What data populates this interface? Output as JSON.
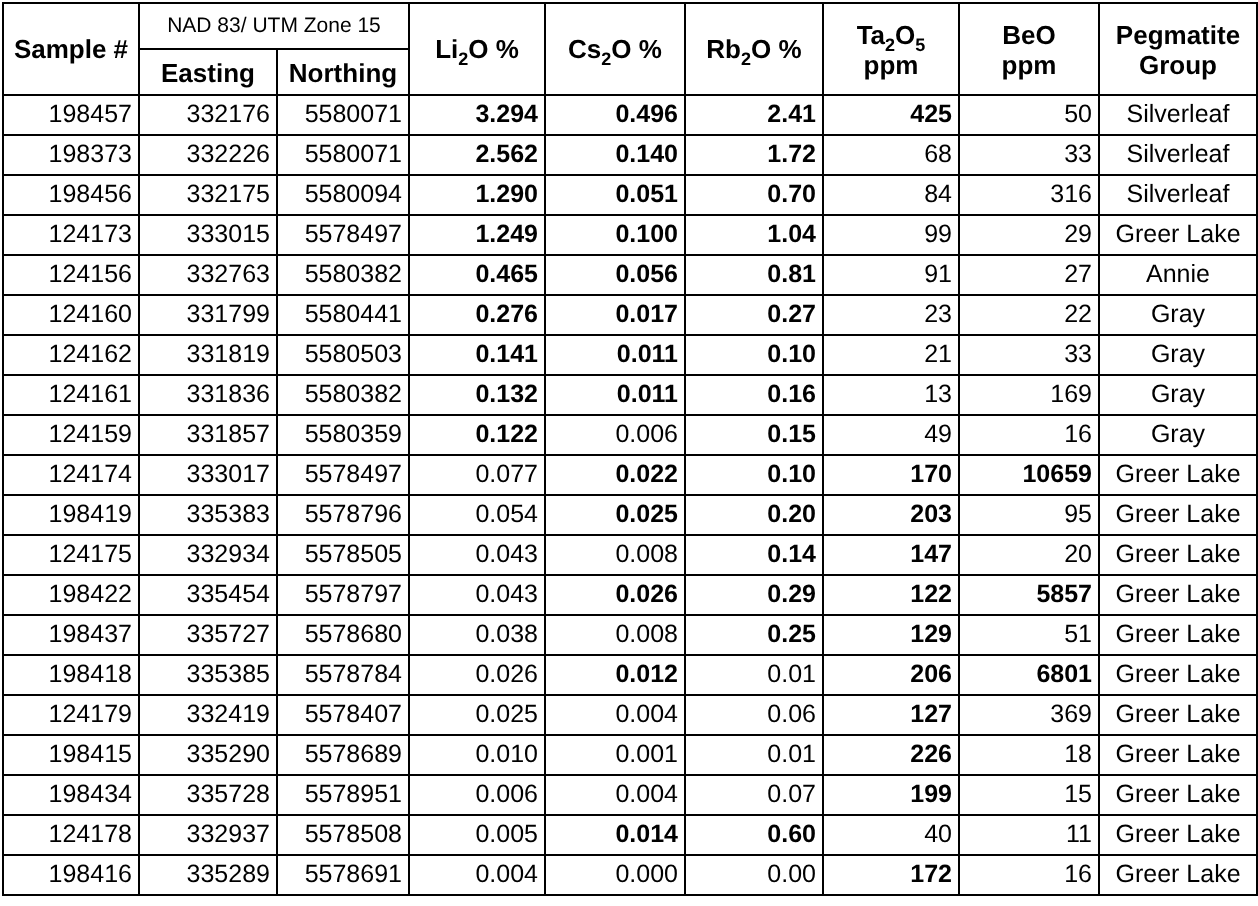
{
  "table": {
    "columns": [
      {
        "lines": [
          "Sample #"
        ]
      },
      {
        "lines": [
          "Easting"
        ]
      },
      {
        "lines": [
          "Northing"
        ]
      },
      {
        "lines": [
          "Li$_{2}$O %"
        ]
      },
      {
        "lines": [
          "Cs$_{2}$O %"
        ]
      },
      {
        "lines": [
          "Rb$_{2}$O %"
        ]
      },
      {
        "lines": [
          "Ta$_{2}$O$_{5}$",
          "ppm"
        ]
      },
      {
        "lines": [
          "BeO",
          "ppm"
        ]
      },
      {
        "lines": [
          "Pegmatite",
          "Group"
        ]
      }
    ],
    "group_header": "NAD 83/ UTM Zone 15",
    "rows": [
      {
        "sample": "198457",
        "easting": "332176",
        "northing": "5580071",
        "assays": [
          {
            "value": "3.294",
            "bold": true
          },
          {
            "value": "0.496",
            "bold": true
          },
          {
            "value": "2.41",
            "bold": true
          },
          {
            "value": "425",
            "bold": true
          },
          {
            "value": "50",
            "bold": false
          }
        ],
        "group": "Silverleaf"
      },
      {
        "sample": "198373",
        "easting": "332226",
        "northing": "5580071",
        "assays": [
          {
            "value": "2.562",
            "bold": true
          },
          {
            "value": "0.140",
            "bold": true
          },
          {
            "value": "1.72",
            "bold": true
          },
          {
            "value": "68",
            "bold": false
          },
          {
            "value": "33",
            "bold": false
          }
        ],
        "group": "Silverleaf"
      },
      {
        "sample": "198456",
        "easting": "332175",
        "northing": "5580094",
        "assays": [
          {
            "value": "1.290",
            "bold": true
          },
          {
            "value": "0.051",
            "bold": true
          },
          {
            "value": "0.70",
            "bold": true
          },
          {
            "value": "84",
            "bold": false
          },
          {
            "value": "316",
            "bold": false
          }
        ],
        "group": "Silverleaf"
      },
      {
        "sample": "124173",
        "easting": "333015",
        "northing": "5578497",
        "assays": [
          {
            "value": "1.249",
            "bold": true
          },
          {
            "value": "0.100",
            "bold": true
          },
          {
            "value": "1.04",
            "bold": true
          },
          {
            "value": "99",
            "bold": false
          },
          {
            "value": "29",
            "bold": false
          }
        ],
        "group": "Greer Lake"
      },
      {
        "sample": "124156",
        "easting": "332763",
        "northing": "5580382",
        "assays": [
          {
            "value": "0.465",
            "bold": true
          },
          {
            "value": "0.056",
            "bold": true
          },
          {
            "value": "0.81",
            "bold": true
          },
          {
            "value": "91",
            "bold": false
          },
          {
            "value": "27",
            "bold": false
          }
        ],
        "group": "Annie"
      },
      {
        "sample": "124160",
        "easting": "331799",
        "northing": "5580441",
        "assays": [
          {
            "value": "0.276",
            "bold": true
          },
          {
            "value": "0.017",
            "bold": true
          },
          {
            "value": "0.27",
            "bold": true
          },
          {
            "value": "23",
            "bold": false
          },
          {
            "value": "22",
            "bold": false
          }
        ],
        "group": "Gray"
      },
      {
        "sample": "124162",
        "easting": "331819",
        "northing": "5580503",
        "assays": [
          {
            "value": "0.141",
            "bold": true
          },
          {
            "value": "0.011",
            "bold": true
          },
          {
            "value": "0.10",
            "bold": true
          },
          {
            "value": "21",
            "bold": false
          },
          {
            "value": "33",
            "bold": false
          }
        ],
        "group": "Gray"
      },
      {
        "sample": "124161",
        "easting": "331836",
        "northing": "5580382",
        "assays": [
          {
            "value": "0.132",
            "bold": true
          },
          {
            "value": "0.011",
            "bold": true
          },
          {
            "value": "0.16",
            "bold": true
          },
          {
            "value": "13",
            "bold": false
          },
          {
            "value": "169",
            "bold": false
          }
        ],
        "group": "Gray"
      },
      {
        "sample": "124159",
        "easting": "331857",
        "northing": "5580359",
        "assays": [
          {
            "value": "0.122",
            "bold": true
          },
          {
            "value": "0.006",
            "bold": false
          },
          {
            "value": "0.15",
            "bold": true
          },
          {
            "value": "49",
            "bold": false
          },
          {
            "value": "16",
            "bold": false
          }
        ],
        "group": "Gray"
      },
      {
        "sample": "124174",
        "easting": "333017",
        "northing": "5578497",
        "assays": [
          {
            "value": "0.077",
            "bold": false
          },
          {
            "value": "0.022",
            "bold": true
          },
          {
            "value": "0.10",
            "bold": true
          },
          {
            "value": "170",
            "bold": true
          },
          {
            "value": "10659",
            "bold": true
          }
        ],
        "group": "Greer Lake"
      },
      {
        "sample": "198419",
        "easting": "335383",
        "northing": "5578796",
        "assays": [
          {
            "value": "0.054",
            "bold": false
          },
          {
            "value": "0.025",
            "bold": true
          },
          {
            "value": "0.20",
            "bold": true
          },
          {
            "value": "203",
            "bold": true
          },
          {
            "value": "95",
            "bold": false
          }
        ],
        "group": "Greer Lake"
      },
      {
        "sample": "124175",
        "easting": "332934",
        "northing": "5578505",
        "assays": [
          {
            "value": "0.043",
            "bold": false
          },
          {
            "value": "0.008",
            "bold": false
          },
          {
            "value": "0.14",
            "bold": true
          },
          {
            "value": "147",
            "bold": true
          },
          {
            "value": "20",
            "bold": false
          }
        ],
        "group": "Greer Lake"
      },
      {
        "sample": "198422",
        "easting": "335454",
        "northing": "5578797",
        "assays": [
          {
            "value": "0.043",
            "bold": false
          },
          {
            "value": "0.026",
            "bold": true
          },
          {
            "value": "0.29",
            "bold": true
          },
          {
            "value": "122",
            "bold": true
          },
          {
            "value": "5857",
            "bold": true
          }
        ],
        "group": "Greer Lake"
      },
      {
        "sample": "198437",
        "easting": "335727",
        "northing": "5578680",
        "assays": [
          {
            "value": "0.038",
            "bold": false
          },
          {
            "value": "0.008",
            "bold": false
          },
          {
            "value": "0.25",
            "bold": true
          },
          {
            "value": "129",
            "bold": true
          },
          {
            "value": "51",
            "bold": false
          }
        ],
        "group": "Greer Lake"
      },
      {
        "sample": "198418",
        "easting": "335385",
        "northing": "5578784",
        "assays": [
          {
            "value": "0.026",
            "bold": false
          },
          {
            "value": "0.012",
            "bold": true
          },
          {
            "value": "0.01",
            "bold": false
          },
          {
            "value": "206",
            "bold": true
          },
          {
            "value": "6801",
            "bold": true
          }
        ],
        "group": "Greer Lake"
      },
      {
        "sample": "124179",
        "easting": "332419",
        "northing": "5578407",
        "assays": [
          {
            "value": "0.025",
            "bold": false
          },
          {
            "value": "0.004",
            "bold": false
          },
          {
            "value": "0.06",
            "bold": false
          },
          {
            "value": "127",
            "bold": true
          },
          {
            "value": "369",
            "bold": false
          }
        ],
        "group": "Greer Lake"
      },
      {
        "sample": "198415",
        "easting": "335290",
        "northing": "5578689",
        "assays": [
          {
            "value": "0.010",
            "bold": false
          },
          {
            "value": "0.001",
            "bold": false
          },
          {
            "value": "0.01",
            "bold": false
          },
          {
            "value": "226",
            "bold": true
          },
          {
            "value": "18",
            "bold": false
          }
        ],
        "group": "Greer Lake"
      },
      {
        "sample": "198434",
        "easting": "335728",
        "northing": "5578951",
        "assays": [
          {
            "value": "0.006",
            "bold": false
          },
          {
            "value": "0.004",
            "bold": false
          },
          {
            "value": "0.07",
            "bold": false
          },
          {
            "value": "199",
            "bold": true
          },
          {
            "value": "15",
            "bold": false
          }
        ],
        "group": "Greer Lake"
      },
      {
        "sample": "124178",
        "easting": "332937",
        "northing": "5578508",
        "assays": [
          {
            "value": "0.005",
            "bold": false
          },
          {
            "value": "0.014",
            "bold": true
          },
          {
            "value": "0.60",
            "bold": true
          },
          {
            "value": "40",
            "bold": false
          },
          {
            "value": "11",
            "bold": false
          }
        ],
        "group": "Greer Lake"
      },
      {
        "sample": "198416",
        "easting": "335289",
        "northing": "5578691",
        "assays": [
          {
            "value": "0.004",
            "bold": false
          },
          {
            "value": "0.000",
            "bold": false
          },
          {
            "value": "0.00",
            "bold": false
          },
          {
            "value": "172",
            "bold": true
          },
          {
            "value": "16",
            "bold": false
          }
        ],
        "group": "Greer Lake"
      }
    ]
  }
}
